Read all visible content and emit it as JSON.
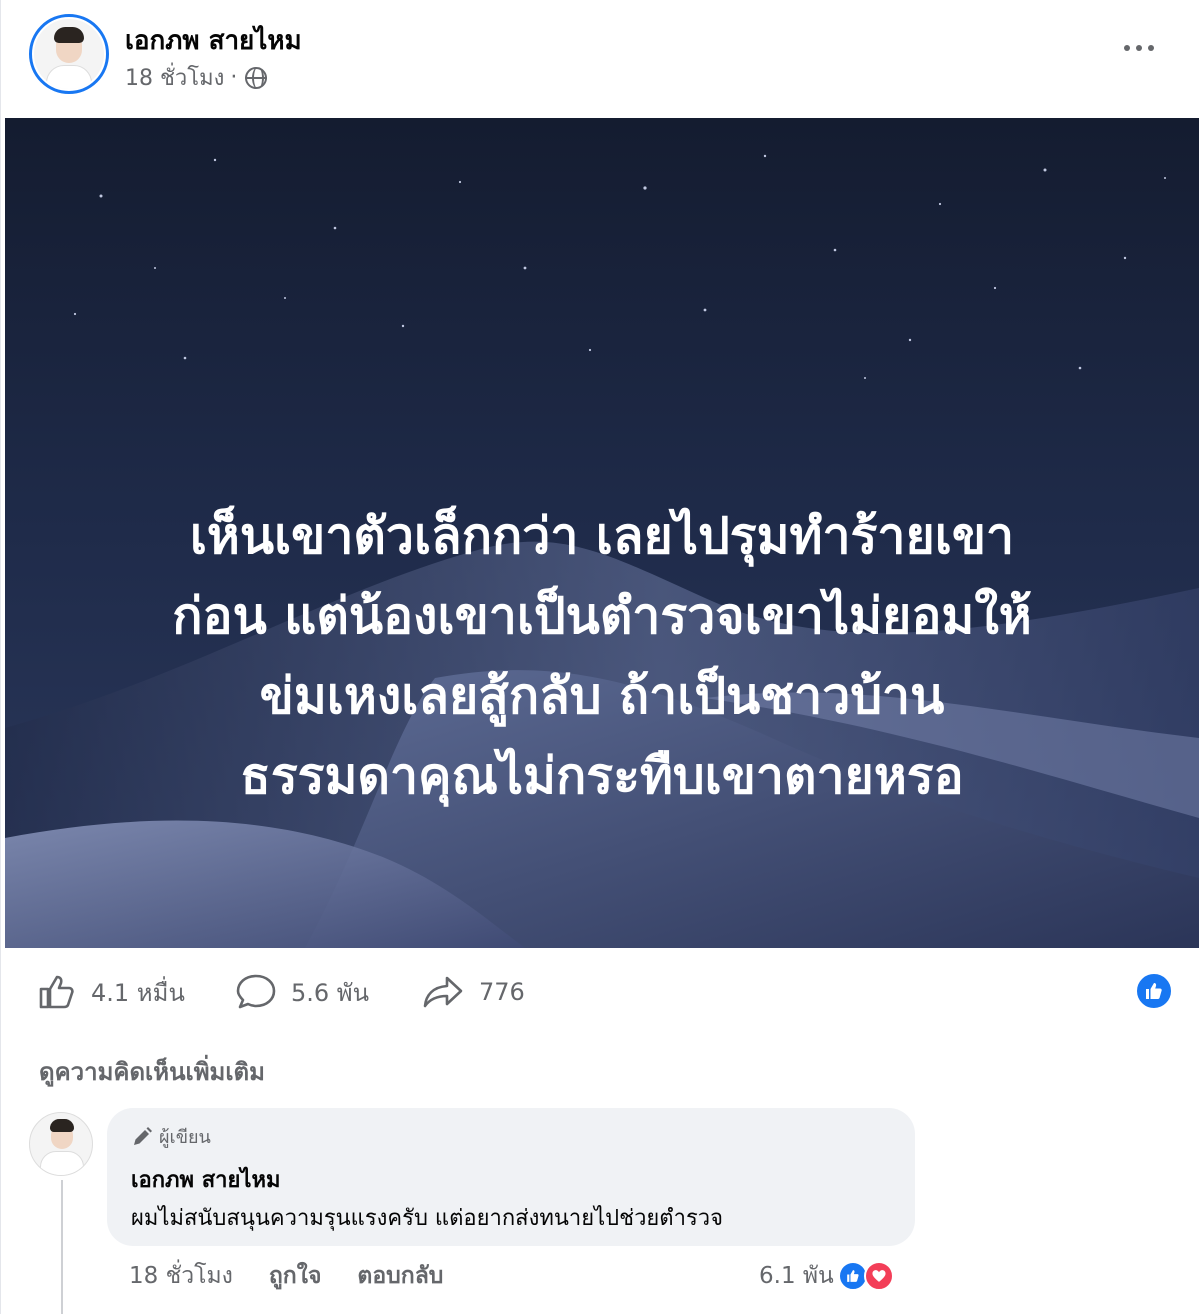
{
  "post": {
    "author_name": "เอกภพ สายไหม",
    "time": "18 ชั่วโมง",
    "separator": "·",
    "image_text_lines": [
      "เห็นเขาตัวเล็กกว่า เลยไปรุมทำร้ายเขา",
      "ก่อน แต่น้องเขาเป็นตำรวจเขาไม่ยอมให้",
      "ข่มเหงเลยสู้กลับ ถ้าเป็นชาวบ้าน",
      "ธรรมดาคุณไม่กระทืบเขาตายหรอ"
    ]
  },
  "stats": {
    "likes": "4.1 หมื่น",
    "comments": "5.6 พัน",
    "shares": "776"
  },
  "more_comments_label": "ดูความคิดเห็นเพิ่มเติม",
  "comment": {
    "badge": "ผู้เขียน",
    "name": "เอกภพ สายไหม",
    "text": "ผมไม่สนับสนุนความรุนแรงครับ แต่อยากส่งทนายไปช่วยตำรวจ",
    "time": "18 ชั่วโมง",
    "like_label": "ถูกใจ",
    "reply_label": "ตอบกลับ",
    "reactions_count": "6.1 พัน"
  },
  "colors": {
    "brand": "#1877f2",
    "love": "#f33e58",
    "secondary_text": "#65676b",
    "bubble": "#f0f2f5"
  },
  "icons": [
    "gear-icon-none",
    "globe-icon",
    "more-icon",
    "like-icon",
    "comment-icon",
    "share-icon",
    "pencil-icon"
  ]
}
